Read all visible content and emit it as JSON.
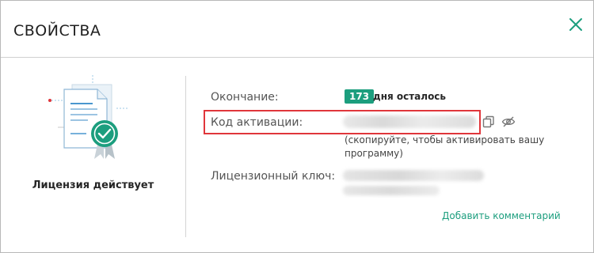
{
  "dialog": {
    "title": "СВОЙСТВА",
    "close_icon": "close-icon"
  },
  "license": {
    "status": "Лицензия действует",
    "illustration_icon": "license-certificate-icon"
  },
  "fields": {
    "end_label": "Окончание:",
    "days_count": "173",
    "days_text": "дня осталось",
    "activation_code_label": "Код активации:",
    "activation_hint": "(скопируйте, чтобы активировать вашу программу)",
    "license_key_label": "Лицензионный ключ:"
  },
  "actions": {
    "add_comment": "Добавить комментарий",
    "copy_icon": "copy-icon",
    "hide_icon": "eye-slash-icon"
  },
  "colors": {
    "accent": "#1c9e7e",
    "highlight": "#e0363b"
  }
}
